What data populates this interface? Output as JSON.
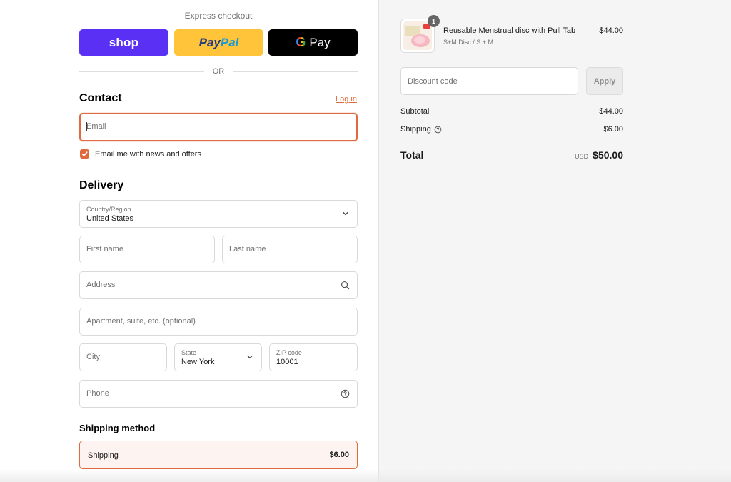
{
  "express": {
    "title": "Express checkout",
    "shop_label": "shop",
    "paypal_part1": "Pay",
    "paypal_part2": "Pal",
    "gpay_g": "G",
    "gpay_label": "Pay",
    "or_label": "OR"
  },
  "contact": {
    "title": "Contact",
    "login_label": "Log in",
    "email_placeholder": "Email",
    "newsletter_label": "Email me with news and offers",
    "newsletter_checked": true
  },
  "delivery": {
    "title": "Delivery",
    "country_label": "Country/Region",
    "country_value": "United States",
    "first_name_placeholder": "First name",
    "last_name_placeholder": "Last name",
    "address_placeholder": "Address",
    "apartment_placeholder": "Apartment, suite, etc. (optional)",
    "city_placeholder": "City",
    "state_label": "State",
    "state_value": "New York",
    "zip_label": "ZIP code",
    "zip_value": "10001",
    "phone_placeholder": "Phone"
  },
  "shipping_method": {
    "title": "Shipping method",
    "option_name": "Shipping",
    "option_price": "$6.00"
  },
  "order": {
    "product_name": "Reusable Menstrual disc with Pull Tab",
    "product_variant": "S+M Disc / S + M",
    "product_price": "$44.00",
    "quantity": "1",
    "discount_placeholder": "Discount code",
    "apply_label": "Apply",
    "subtotal_label": "Subtotal",
    "subtotal_value": "$44.00",
    "shipping_label": "Shipping",
    "shipping_value": "$6.00",
    "total_label": "Total",
    "currency": "USD",
    "total_value": "$50.00"
  },
  "colors": {
    "accent": "#e0693d",
    "shop_purple": "#5a31f4",
    "paypal_yellow": "#ffc439",
    "gpay_black": "#000000"
  },
  "icons": {
    "country_select": "chevron-down-icon",
    "address": "search-icon",
    "phone": "help-circle-icon",
    "shipping_info": "help-circle-icon"
  }
}
